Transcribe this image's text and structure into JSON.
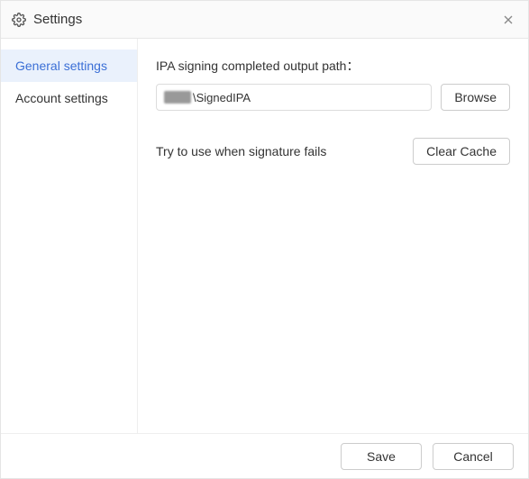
{
  "window": {
    "title": "Settings"
  },
  "sidebar": {
    "items": [
      {
        "label": "General settings",
        "active": true
      },
      {
        "label": "Account settings",
        "active": false
      }
    ]
  },
  "main": {
    "output_path_label": "IPA signing completed output path：",
    "output_path_value": "\\SignedIPA",
    "browse_label": "Browse",
    "signature_fail_label": "Try to use when signature fails",
    "clear_cache_label": "Clear Cache"
  },
  "footer": {
    "save_label": "Save",
    "cancel_label": "Cancel"
  }
}
